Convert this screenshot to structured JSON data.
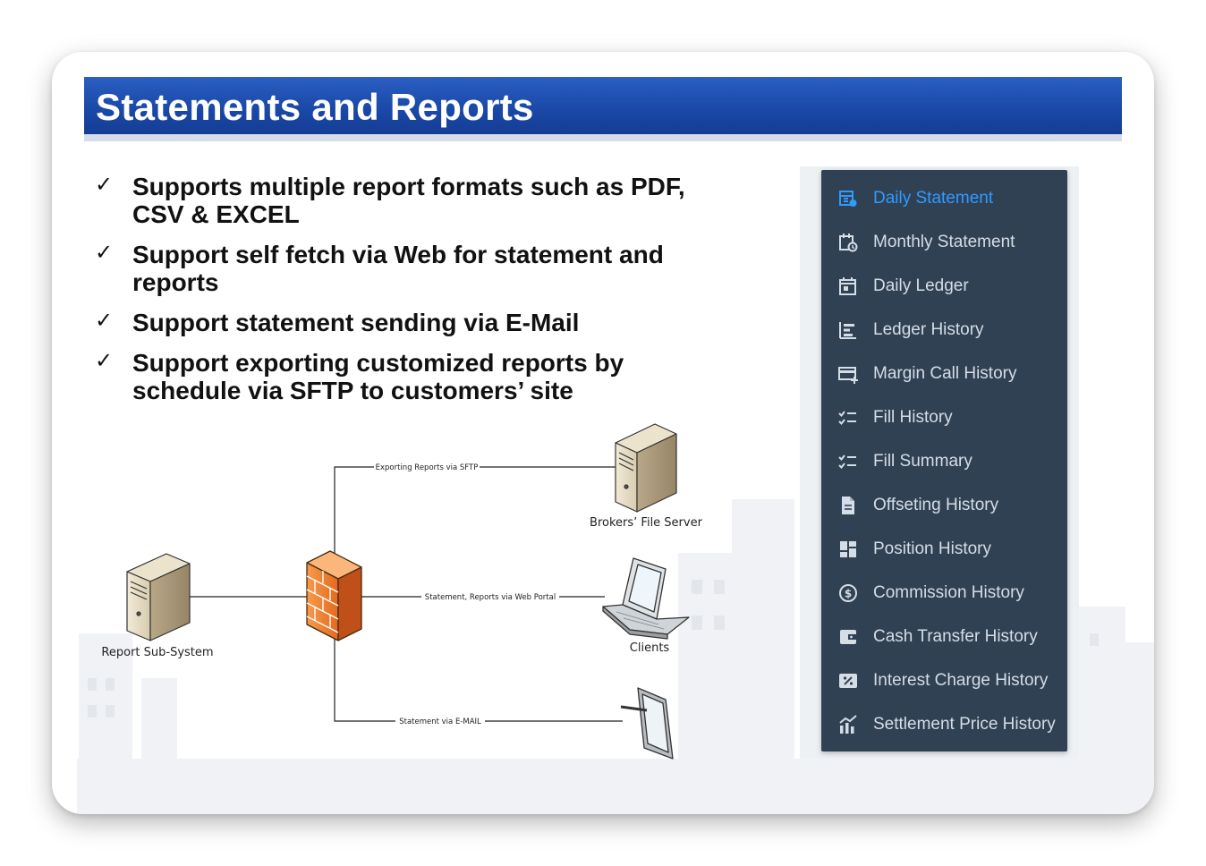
{
  "title": "Statements and Reports",
  "bullets": [
    {
      "line1": "Supports multiple report formats such as PDF,",
      "line2": "CSV & EXCEL"
    },
    {
      "line1": "Support self fetch via Web for statement and",
      "line2": "reports"
    },
    {
      "line1": "Support statement sending via E-Mail",
      "line2": ""
    },
    {
      "line1": "Support exporting customized reports by",
      "line2": "schedule via SFTP to customers’ site"
    }
  ],
  "check_mark": "✓",
  "diagram": {
    "nodes": {
      "report_subsystem": "Report Sub-System",
      "brokers_file_server": "Brokers’ File Server",
      "clients": "Clients"
    },
    "edges": {
      "sftp": "Exporting Reports via SFTP",
      "web_portal": "Statement, Reports via Web Portal",
      "email": "Statement via E-MAIL"
    }
  },
  "menu": {
    "active_color": "#2f9bff",
    "items": [
      {
        "label": "Daily Statement",
        "icon": "daily-statement-icon",
        "active": true
      },
      {
        "label": "Monthly Statement",
        "icon": "monthly-statement-icon",
        "active": false
      },
      {
        "label": "Daily Ledger",
        "icon": "calendar-icon",
        "active": false
      },
      {
        "label": "Ledger History",
        "icon": "ledger-history-icon",
        "active": false
      },
      {
        "label": "Margin Call History",
        "icon": "card-plus-icon",
        "active": false
      },
      {
        "label": "Fill History",
        "icon": "checklist-icon",
        "active": false
      },
      {
        "label": "Fill Summary",
        "icon": "checklist-icon",
        "active": false
      },
      {
        "label": "Offseting History",
        "icon": "document-icon",
        "active": false
      },
      {
        "label": "Position History",
        "icon": "dashboard-icon",
        "active": false
      },
      {
        "label": "Commission History",
        "icon": "dollar-circle-icon",
        "active": false
      },
      {
        "label": "Cash Transfer History",
        "icon": "wallet-icon",
        "active": false
      },
      {
        "label": "Interest Charge History",
        "icon": "percent-icon",
        "active": false
      },
      {
        "label": "Settlement Price History",
        "icon": "bar-chart-icon",
        "active": false
      }
    ]
  }
}
